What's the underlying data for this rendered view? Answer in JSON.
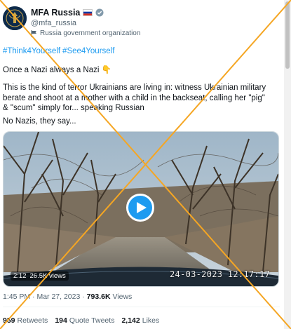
{
  "account": {
    "name": "MFA Russia",
    "flag": "🇷🇺",
    "handle": "@mfa_russia",
    "label": "Russia government organization"
  },
  "tweet": {
    "hashtags": [
      "#Think4Yourself",
      "#See4Yourself"
    ],
    "line1": "Once a Nazi always a Nazi 👇",
    "paragraph": "This is the kind of terror Ukrainians are living in: witness Ukrainian military berate and shoot at a mother with a child in the backseat, calling her \"pig\" & \"scum\" simply for... speaking Russian",
    "line3": "No Nazis, they say..."
  },
  "video": {
    "duration": "2:12",
    "views": "26.5K views",
    "timestamp": "24-03-2023 12:17:17"
  },
  "meta": {
    "time": "1:45 PM",
    "date": "Mar 27, 2023",
    "views_count": "793.6K",
    "views_label": "Views"
  },
  "stats": {
    "retweets_count": "959",
    "retweets_label": "Retweets",
    "quotes_count": "194",
    "quotes_label": "Quote Tweets",
    "likes_count": "2,142",
    "likes_label": "Likes"
  },
  "colors": {
    "accent": "#1d9bf0",
    "overlay_cross": "#f5a623"
  }
}
